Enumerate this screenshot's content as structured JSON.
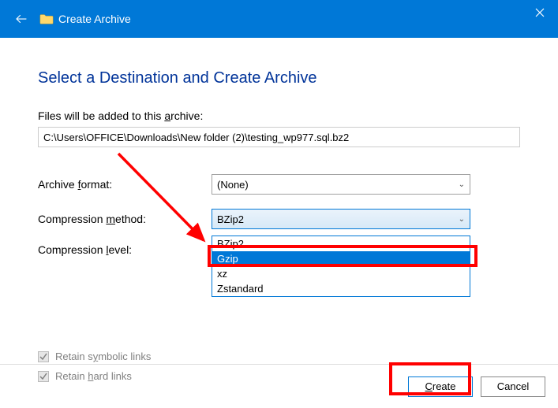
{
  "titlebar": {
    "title": "Create Archive"
  },
  "heading": "Select a Destination and Create Archive",
  "archive_label_pre": "Files will be added to this ",
  "archive_label_u": "a",
  "archive_label_post": "rchive:",
  "path": "C:\\Users\\OFFICE\\Downloads\\New folder (2)\\testing_wp977.sql.bz2",
  "format": {
    "label_pre": "Archive ",
    "label_u": "f",
    "label_post": "ormat:",
    "value": "(None)"
  },
  "method": {
    "label_pre": "Compression ",
    "label_u": "m",
    "label_post": "ethod:",
    "value": "BZip2",
    "options": [
      "BZip2",
      "Gzip",
      "xz",
      "Zstandard"
    ],
    "selected": "Gzip"
  },
  "level": {
    "label_pre": "Compression ",
    "label_u": "l",
    "label_post": "evel:"
  },
  "checks": {
    "symbolic_pre": "Retain s",
    "symbolic_u": "y",
    "symbolic_post": "mbolic links",
    "hard_pre": "Retain ",
    "hard_u": "h",
    "hard_post": "ard links"
  },
  "buttons": {
    "create_u": "C",
    "create_post": "reate",
    "cancel": "Cancel"
  }
}
